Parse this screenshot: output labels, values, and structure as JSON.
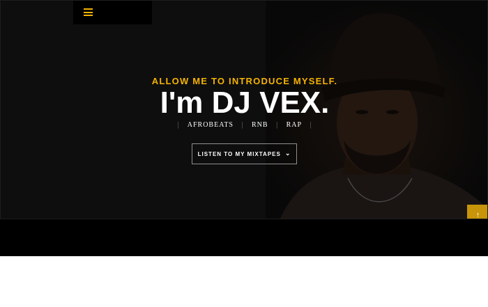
{
  "hero": {
    "intro": "ALLOW ME TO INTRODUCE MYSELF.",
    "headline": "I'm DJ VEX.",
    "genres": [
      "AFROBEATS",
      "RNB",
      "RAP"
    ],
    "cta_label": "LISTEN TO MY MIXTAPES",
    "cta_icon": "chevron-down-icon",
    "accent_color": "#f5b301"
  },
  "nav": {
    "menu_icon": "hamburger-icon"
  },
  "scroll_top": {
    "icon": "arrow-up-icon",
    "glyph": "↑"
  }
}
